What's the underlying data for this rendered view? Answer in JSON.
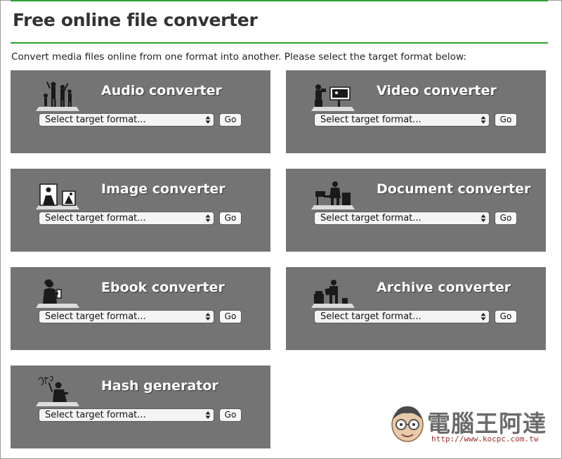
{
  "page": {
    "title": "Free online file converter",
    "intro": "Convert media files online from one format into another. Please select the target format below:"
  },
  "converters": [
    {
      "name": "Audio converter",
      "icon": "audio-silhouette-icon",
      "select_value": "Select target format...",
      "go_label": "Go"
    },
    {
      "name": "Video converter",
      "icon": "video-silhouette-icon",
      "select_value": "Select target format...",
      "go_label": "Go"
    },
    {
      "name": "Image converter",
      "icon": "image-silhouette-icon",
      "select_value": "Select target format...",
      "go_label": "Go"
    },
    {
      "name": "Document converter",
      "icon": "document-silhouette-icon",
      "select_value": "Select target format...",
      "go_label": "Go"
    },
    {
      "name": "Ebook converter",
      "icon": "ebook-silhouette-icon",
      "select_value": "Select target format...",
      "go_label": "Go"
    },
    {
      "name": "Archive converter",
      "icon": "archive-silhouette-icon",
      "select_value": "Select target format...",
      "go_label": "Go"
    },
    {
      "name": "Hash generator",
      "icon": "hash-silhouette-icon",
      "select_value": "Select target format...",
      "go_label": "Go"
    }
  ],
  "watermark": {
    "text": "電腦王阿達",
    "url": "http://www.kocpc.com.tw",
    "icon": "mascot-face-icon"
  },
  "colors": {
    "accent_green": "#2f9e2f",
    "card_bg": "#747474",
    "title_text": "#333333"
  }
}
